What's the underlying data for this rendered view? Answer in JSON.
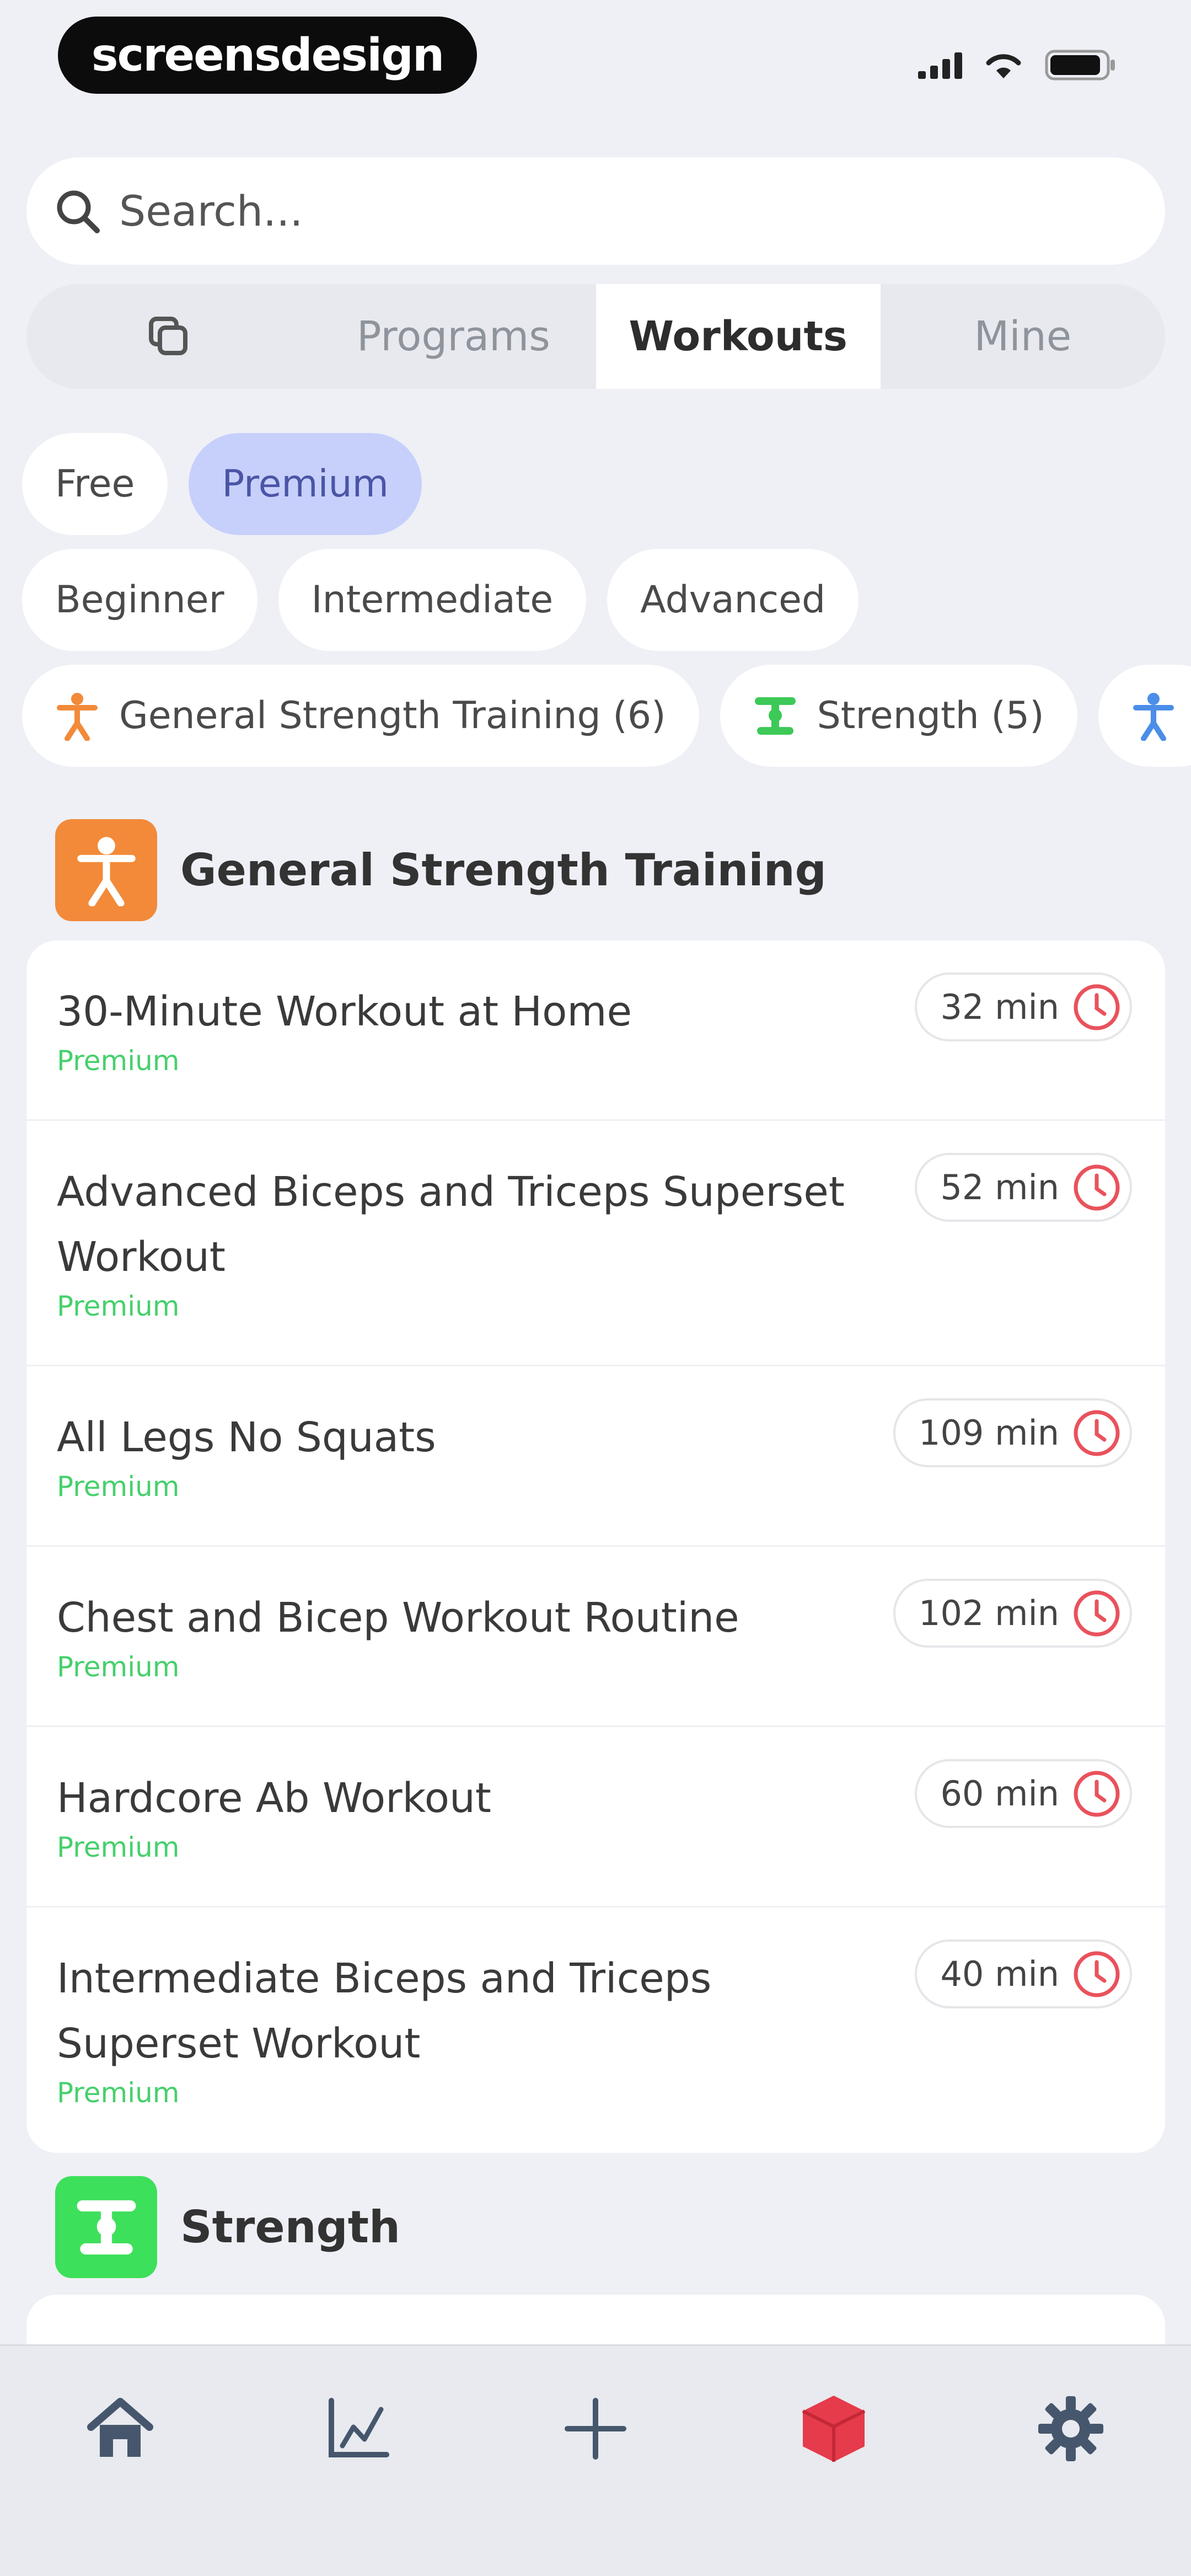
{
  "status_bar": {
    "brand": "screensdesign"
  },
  "search": {
    "placeholder": "Search..."
  },
  "segments": {
    "programs": "Programs",
    "workouts": "Workouts",
    "mine": "Mine"
  },
  "filters": {
    "access": [
      "Free",
      "Premium"
    ],
    "levels": [
      "Beginner",
      "Intermediate",
      "Advanced"
    ],
    "categories": [
      "General Strength Training (6)",
      "Strength (5)"
    ]
  },
  "sections": [
    {
      "title": "General Strength Training",
      "color": "#f28a3a",
      "items": [
        {
          "title": "30-Minute Workout at Home",
          "tag": "Premium",
          "duration": "32 min"
        },
        {
          "title": "Advanced Biceps and Triceps Superset Workout",
          "tag": "Premium",
          "duration": "52 min"
        },
        {
          "title": "All Legs No Squats",
          "tag": "Premium",
          "duration": "109 min"
        },
        {
          "title": "Chest and Bicep Workout Routine",
          "tag": "Premium",
          "duration": "102 min"
        },
        {
          "title": "Hardcore Ab Workout",
          "tag": "Premium",
          "duration": "60 min"
        },
        {
          "title": "Intermediate Biceps and Triceps Superset Workout",
          "tag": "Premium",
          "duration": "40 min"
        }
      ]
    },
    {
      "title": "Strength",
      "color": "#3de05a"
    }
  ],
  "tab_bar": [
    "home-icon",
    "chart-icon",
    "plus-icon",
    "cube-icon",
    "gear-icon"
  ],
  "colors": {
    "accent": "#c7d0fb",
    "premium": "#46d06c",
    "clock": "#e9525c",
    "active_tab": "#e53b4a"
  }
}
